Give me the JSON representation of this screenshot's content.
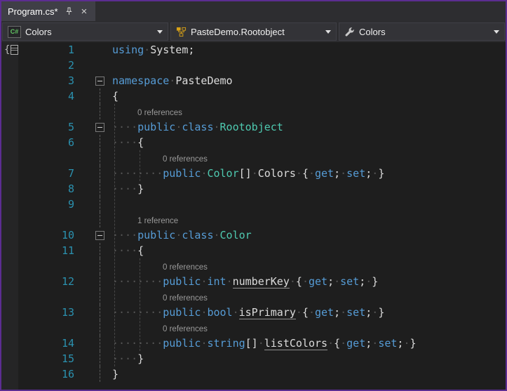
{
  "theme": {
    "border": "#5c2d91",
    "titlebar_bg": "#2d2d30",
    "tab_bg": "#3f3f46",
    "editor_bg": "#1e1e1e",
    "glyph_margin_bg": "#252526",
    "keyword": "#569cd6",
    "type": "#4ec9b0",
    "plain": "#dcdcdc",
    "whitespace_dot": "#555555",
    "codelens": "#999999",
    "line_number": "#2b91af"
  },
  "tab_bar": {
    "tabs": [
      {
        "title": "Program.cs*",
        "pinned": true
      }
    ],
    "close_glyph": "×"
  },
  "nav_bar": {
    "dropdowns": [
      {
        "id": "project",
        "icon": "csharp-project-icon",
        "icon_text": "C#",
        "label": "Colors"
      },
      {
        "id": "type",
        "icon": "class-hierarchy-icon",
        "label": "PasteDemo.Rootobject"
      },
      {
        "id": "member",
        "icon": "wrench-icon",
        "label": "Colors"
      }
    ]
  },
  "editor": {
    "rows": [
      {
        "kind": "code",
        "num": "1",
        "gutter": "",
        "segs": [
          [
            "k",
            "using"
          ],
          [
            "w",
            "·"
          ],
          [
            "p",
            "System;"
          ]
        ]
      },
      {
        "kind": "code",
        "num": "2",
        "gutter": "",
        "segs": []
      },
      {
        "kind": "code",
        "num": "3",
        "gutter": "box",
        "segs": [
          [
            "k",
            "namespace"
          ],
          [
            "w",
            "·"
          ],
          [
            "p",
            "PasteDemo"
          ]
        ]
      },
      {
        "kind": "code",
        "num": "4",
        "gutter": "line",
        "segs": [
          [
            "p",
            "{"
          ]
        ]
      },
      {
        "kind": "lens",
        "indent": 4,
        "gutter": "line",
        "text": "0 references"
      },
      {
        "kind": "code",
        "num": "5",
        "gutter": "box",
        "segs": [
          [
            "w",
            "····"
          ],
          [
            "k",
            "public"
          ],
          [
            "w",
            "·"
          ],
          [
            "k",
            "class"
          ],
          [
            "w",
            "·"
          ],
          [
            "t",
            "Rootobject"
          ]
        ]
      },
      {
        "kind": "code",
        "num": "6",
        "gutter": "line",
        "segs": [
          [
            "w",
            "····"
          ],
          [
            "p",
            "{"
          ]
        ]
      },
      {
        "kind": "lens",
        "indent": 8,
        "gutter": "line",
        "text": "0 references"
      },
      {
        "kind": "code",
        "num": "7",
        "gutter": "line",
        "segs": [
          [
            "w",
            "········"
          ],
          [
            "k",
            "public"
          ],
          [
            "w",
            "·"
          ],
          [
            "t",
            "Color"
          ],
          [
            "p",
            "[]"
          ],
          [
            "w",
            "·"
          ],
          [
            "p",
            "Colors"
          ],
          [
            "w",
            "·"
          ],
          [
            "p",
            "{"
          ],
          [
            "w",
            "·"
          ],
          [
            "k",
            "get"
          ],
          [
            "p",
            ";"
          ],
          [
            "w",
            "·"
          ],
          [
            "k",
            "set"
          ],
          [
            "p",
            ";"
          ],
          [
            "w",
            "·"
          ],
          [
            "p",
            "}"
          ]
        ]
      },
      {
        "kind": "code",
        "num": "8",
        "gutter": "line",
        "segs": [
          [
            "w",
            "····"
          ],
          [
            "p",
            "}"
          ]
        ]
      },
      {
        "kind": "code",
        "num": "9",
        "gutter": "line",
        "segs": []
      },
      {
        "kind": "lens",
        "indent": 4,
        "gutter": "line",
        "text": "1 reference"
      },
      {
        "kind": "code",
        "num": "10",
        "gutter": "box",
        "segs": [
          [
            "w",
            "····"
          ],
          [
            "k",
            "public"
          ],
          [
            "w",
            "·"
          ],
          [
            "k",
            "class"
          ],
          [
            "w",
            "·"
          ],
          [
            "t",
            "Color"
          ]
        ]
      },
      {
        "kind": "code",
        "num": "11",
        "gutter": "line",
        "segs": [
          [
            "w",
            "····"
          ],
          [
            "p",
            "{"
          ]
        ]
      },
      {
        "kind": "lens",
        "indent": 8,
        "gutter": "line",
        "text": "0 references"
      },
      {
        "kind": "code",
        "num": "12",
        "gutter": "line",
        "segs": [
          [
            "w",
            "········"
          ],
          [
            "k",
            "public"
          ],
          [
            "w",
            "·"
          ],
          [
            "k",
            "int"
          ],
          [
            "w",
            "·"
          ],
          [
            "u",
            "numberKey"
          ],
          [
            "w",
            "·"
          ],
          [
            "p",
            "{"
          ],
          [
            "w",
            "·"
          ],
          [
            "k",
            "get"
          ],
          [
            "p",
            ";"
          ],
          [
            "w",
            "·"
          ],
          [
            "k",
            "set"
          ],
          [
            "p",
            ";"
          ],
          [
            "w",
            "·"
          ],
          [
            "p",
            "}"
          ]
        ]
      },
      {
        "kind": "lens",
        "indent": 8,
        "gutter": "line",
        "text": "0 references"
      },
      {
        "kind": "code",
        "num": "13",
        "gutter": "line",
        "segs": [
          [
            "w",
            "········"
          ],
          [
            "k",
            "public"
          ],
          [
            "w",
            "·"
          ],
          [
            "k",
            "bool"
          ],
          [
            "w",
            "·"
          ],
          [
            "u",
            "isPrimary"
          ],
          [
            "w",
            "·"
          ],
          [
            "p",
            "{"
          ],
          [
            "w",
            "·"
          ],
          [
            "k",
            "get"
          ],
          [
            "p",
            ";"
          ],
          [
            "w",
            "·"
          ],
          [
            "k",
            "set"
          ],
          [
            "p",
            ";"
          ],
          [
            "w",
            "·"
          ],
          [
            "p",
            "}"
          ]
        ]
      },
      {
        "kind": "lens",
        "indent": 8,
        "gutter": "line",
        "text": "0 references"
      },
      {
        "kind": "code",
        "num": "14",
        "gutter": "line",
        "segs": [
          [
            "w",
            "········"
          ],
          [
            "k",
            "public"
          ],
          [
            "w",
            "·"
          ],
          [
            "k",
            "string"
          ],
          [
            "p",
            "[]"
          ],
          [
            "w",
            "·"
          ],
          [
            "u",
            "listColors"
          ],
          [
            "w",
            "·"
          ],
          [
            "p",
            "{"
          ],
          [
            "w",
            "·"
          ],
          [
            "k",
            "get"
          ],
          [
            "p",
            ";"
          ],
          [
            "w",
            "·"
          ],
          [
            "k",
            "set"
          ],
          [
            "p",
            ";"
          ],
          [
            "w",
            "·"
          ],
          [
            "p",
            "}"
          ]
        ]
      },
      {
        "kind": "code",
        "num": "15",
        "gutter": "line",
        "segs": [
          [
            "w",
            "····"
          ],
          [
            "p",
            "}"
          ]
        ]
      },
      {
        "kind": "code",
        "num": "16",
        "gutter": "line",
        "segs": [
          [
            "p",
            "}"
          ]
        ]
      }
    ]
  }
}
